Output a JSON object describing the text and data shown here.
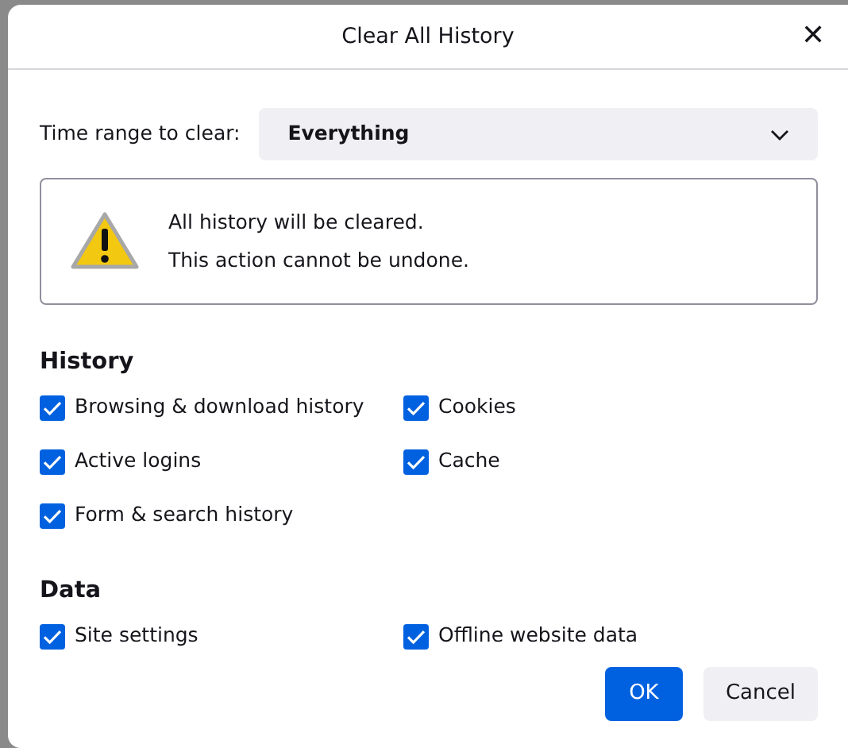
{
  "window": {
    "title": "Clear All History",
    "close": "✕"
  },
  "time_range": {
    "label": "Time range to clear:",
    "value": "Everything"
  },
  "warning": {
    "lines": [
      "All history will be cleared.",
      "This action cannot be undone."
    ]
  },
  "sections": [
    {
      "heading": "History",
      "items": [
        {
          "label": "Browsing & download history",
          "checked": true
        },
        {
          "label": "Cookies",
          "checked": true
        },
        {
          "label": "Active logins",
          "checked": true
        },
        {
          "label": "Cache",
          "checked": true
        },
        {
          "label": "Form & search history",
          "checked": true
        }
      ]
    },
    {
      "heading": "Data",
      "items": [
        {
          "label": "Site settings",
          "checked": true
        },
        {
          "label": "Offline website data",
          "checked": true
        }
      ]
    }
  ],
  "buttons": [
    {
      "label": "OK",
      "kind": "primary"
    },
    {
      "label": "Cancel",
      "kind": "secondary"
    }
  ]
}
